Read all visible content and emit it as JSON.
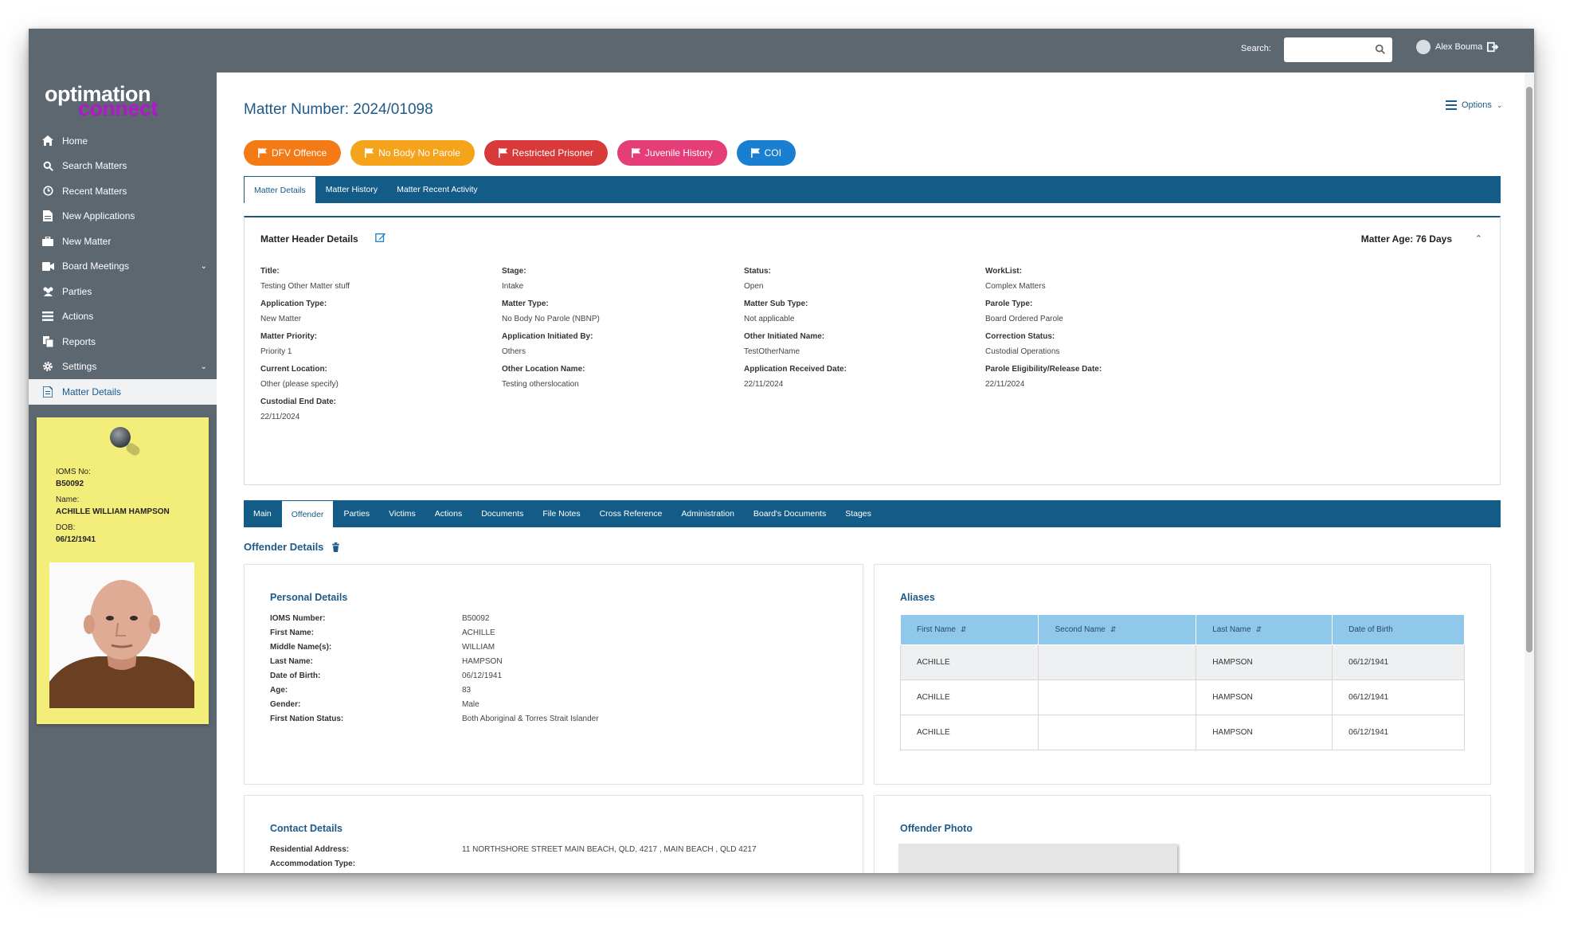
{
  "topbar": {
    "search_label": "Search:",
    "search_value": "",
    "user_name": "Alex Bouma"
  },
  "logo": {
    "line1": "optimation",
    "line2": "connect"
  },
  "sidebar": {
    "items": [
      {
        "label": "Home",
        "icon": "home-icon"
      },
      {
        "label": "Search Matters",
        "icon": "search-icon"
      },
      {
        "label": "Recent Matters",
        "icon": "clock-icon"
      },
      {
        "label": "New Applications",
        "icon": "file-icon"
      },
      {
        "label": "New Matter",
        "icon": "briefcase-icon"
      },
      {
        "label": "Board Meetings",
        "icon": "video-icon",
        "has_chevron": true
      },
      {
        "label": "Parties",
        "icon": "users-icon"
      },
      {
        "label": "Actions",
        "icon": "list-icon"
      },
      {
        "label": "Reports",
        "icon": "copy-icon"
      },
      {
        "label": "Settings",
        "icon": "gear-icon",
        "has_chevron": true
      },
      {
        "label": "Matter Details",
        "icon": "document-icon",
        "active": true
      }
    ]
  },
  "sticky": {
    "ioms_label": "IOMS No:",
    "ioms": "B50092",
    "name_label": "Name:",
    "name": "ACHILLE WILLIAM HAMPSON",
    "dob_label": "DOB:",
    "dob": "06/12/1941"
  },
  "page": {
    "title": "Matter Number: 2024/01098",
    "options": "Options"
  },
  "badges": [
    {
      "label": "DFV Offence",
      "color": "#f47a16"
    },
    {
      "label": "No Body No Parole",
      "color": "#f5a31a"
    },
    {
      "label": "Restricted Prisoner",
      "color": "#d9393b"
    },
    {
      "label": "Juvenile History",
      "color": "#e53d77"
    },
    {
      "label": "COI",
      "color": "#1b7fd1"
    }
  ],
  "tabs1": [
    "Matter Details",
    "Matter History",
    "Matter Recent Activity"
  ],
  "header": {
    "title": "Matter Header Details",
    "age": "Matter Age: 76 Days",
    "fields": [
      {
        "label": "Title:",
        "value": "Testing Other Matter stuff"
      },
      {
        "label": "Stage:",
        "value": "Intake"
      },
      {
        "label": "Status:",
        "value": "Open"
      },
      {
        "label": "WorkList:",
        "value": "Complex Matters"
      },
      {
        "label": "Application Type:",
        "value": "New Matter"
      },
      {
        "label": "Matter Type:",
        "value": "No Body No Parole (NBNP)"
      },
      {
        "label": "Matter Sub Type:",
        "value": "Not applicable"
      },
      {
        "label": "Parole Type:",
        "value": "Board Ordered Parole"
      },
      {
        "label": "Matter Priority:",
        "value": "Priority 1"
      },
      {
        "label": "Application Initiated By:",
        "value": "Others"
      },
      {
        "label": "Other Initiated Name:",
        "value": "TestOtherName"
      },
      {
        "label": "Correction Status:",
        "value": "Custodial Operations"
      },
      {
        "label": "Current Location:",
        "value": "Other (please specify)"
      },
      {
        "label": "Other Location Name:",
        "value": "Testing otherslocation"
      },
      {
        "label": "Application Received Date:",
        "value": "22/11/2024"
      },
      {
        "label": "Parole Eligibility/Release Date:",
        "value": "22/11/2024"
      },
      {
        "label": "Custodial End Date:",
        "value": "22/11/2024"
      }
    ]
  },
  "tabs2": [
    "Main",
    "Offender",
    "Parties",
    "Victims",
    "Actions",
    "Documents",
    "File Notes",
    "Cross Reference",
    "Administration",
    "Board's Documents",
    "Stages"
  ],
  "offender": {
    "section_title": "Offender Details"
  },
  "personal": {
    "title": "Personal Details",
    "rows": [
      {
        "k": "IOMS Number:",
        "v": "B50092"
      },
      {
        "k": "First Name:",
        "v": "ACHILLE"
      },
      {
        "k": "Middle Name(s):",
        "v": "WILLIAM"
      },
      {
        "k": "Last Name:",
        "v": "HAMPSON"
      },
      {
        "k": "Date of Birth:",
        "v": "06/12/1941"
      },
      {
        "k": "Age:",
        "v": "83"
      },
      {
        "k": "Gender:",
        "v": "Male"
      },
      {
        "k": "First Nation Status:",
        "v": "Both Aboriginal & Torres Strait Islander"
      }
    ]
  },
  "aliases": {
    "title": "Aliases",
    "columns": [
      "First Name",
      "Second Name",
      "Last Name",
      "Date of Birth"
    ],
    "rows": [
      [
        "ACHILLE",
        "",
        "HAMPSON",
        "06/12/1941"
      ],
      [
        "ACHILLE",
        "",
        "HAMPSON",
        "06/12/1941"
      ],
      [
        "ACHILLE",
        "",
        "HAMPSON",
        "06/12/1941"
      ]
    ]
  },
  "contact": {
    "title": "Contact Details",
    "rows": [
      {
        "k": "Residential Address:",
        "v": "11 NORTHSHORE STREET MAIN BEACH, QLD, 4217 , MAIN BEACH , QLD 4217"
      },
      {
        "k": "Accommodation Type:",
        "v": ""
      }
    ]
  },
  "photo": {
    "title": "Offender Photo"
  }
}
